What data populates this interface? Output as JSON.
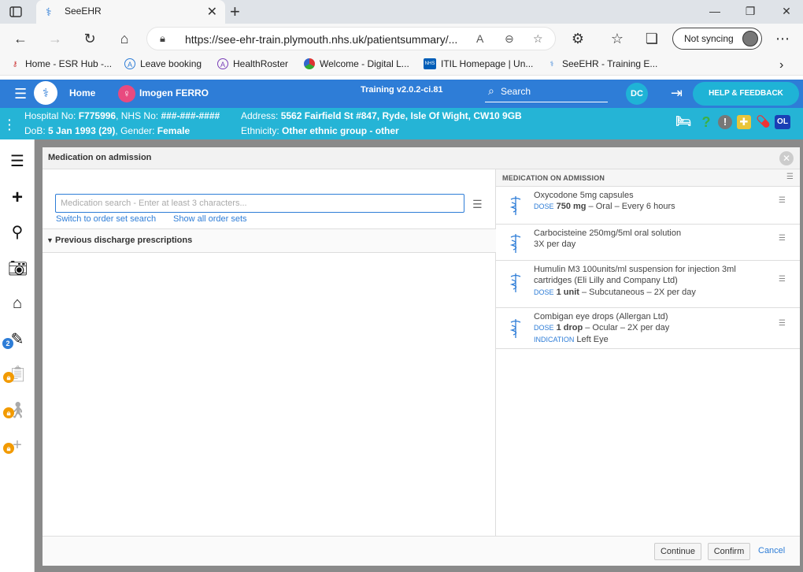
{
  "browser": {
    "tab_title": "SeeEHR",
    "url": "https://see-ehr-train.plymouth.nhs.uk/patientsummary/...",
    "sync_label": "Not syncing",
    "bookmarks": [
      "Home - ESR Hub -...",
      "Leave booking",
      "HealthRoster",
      "Welcome - Digital L...",
      "ITIL Homepage | Un...",
      "SeeEHR - Training E..."
    ]
  },
  "app": {
    "home_label": "Home",
    "patient_name": "Imogen FERRO",
    "version": "Training v2.0.2-ci.81",
    "search_label": "Search",
    "user_initials": "DC",
    "help_label": "HELP & FEEDBACK"
  },
  "patient": {
    "hospital_label": "Hospital No:",
    "hospital_no": "F775996",
    "nhs_label": "NHS No:",
    "nhs_no": "###-###-####",
    "address_label": "Address:",
    "address": "5562 Fairfield St #847, Ryde, Isle Of Wight, CW10 9GB",
    "dob_label": "DoB:",
    "dob": "5 Jan 1993 (29)",
    "gender_label": "Gender:",
    "gender": "Female",
    "ethnicity_label": "Ethnicity:",
    "ethnicity": "Other ethnic group - other",
    "ol_badge": "OL"
  },
  "rail": {
    "badge_count": "2"
  },
  "modal": {
    "title": "Medication on admission",
    "search_placeholder": "Medication search - Enter at least 3 characters...",
    "switch_link": "Switch to order set search",
    "show_all_link": "Show all order sets",
    "prev_section": "Previous discharge prescriptions",
    "right_header": "MEDICATION ON ADMISSION",
    "medications": [
      {
        "name": "Oxycodone 5mg capsules",
        "dose_kw": "DOSE",
        "dose": "750 mg",
        "rest": " – Oral – Every 6 hours"
      },
      {
        "name": "Carbocisteine 250mg/5ml oral solution",
        "line2": "3X per day"
      },
      {
        "name": "Humulin M3 100units/ml suspension for injection 3ml cartridges (Eli Lilly and Company Ltd)",
        "dose_kw": "DOSE",
        "dose": "1 unit",
        "rest": " – Subcutaneous – 2X per day"
      },
      {
        "name": "Combigan eye drops (Allergan Ltd)",
        "dose_kw": "DOSE",
        "dose": "1 drop",
        "rest": " – Ocular – 2X per day",
        "indication_kw": "INDICATION",
        "indication": "Left Eye"
      }
    ],
    "footer": {
      "continue": "Continue",
      "confirm": "Confirm",
      "cancel": "Cancel"
    }
  }
}
